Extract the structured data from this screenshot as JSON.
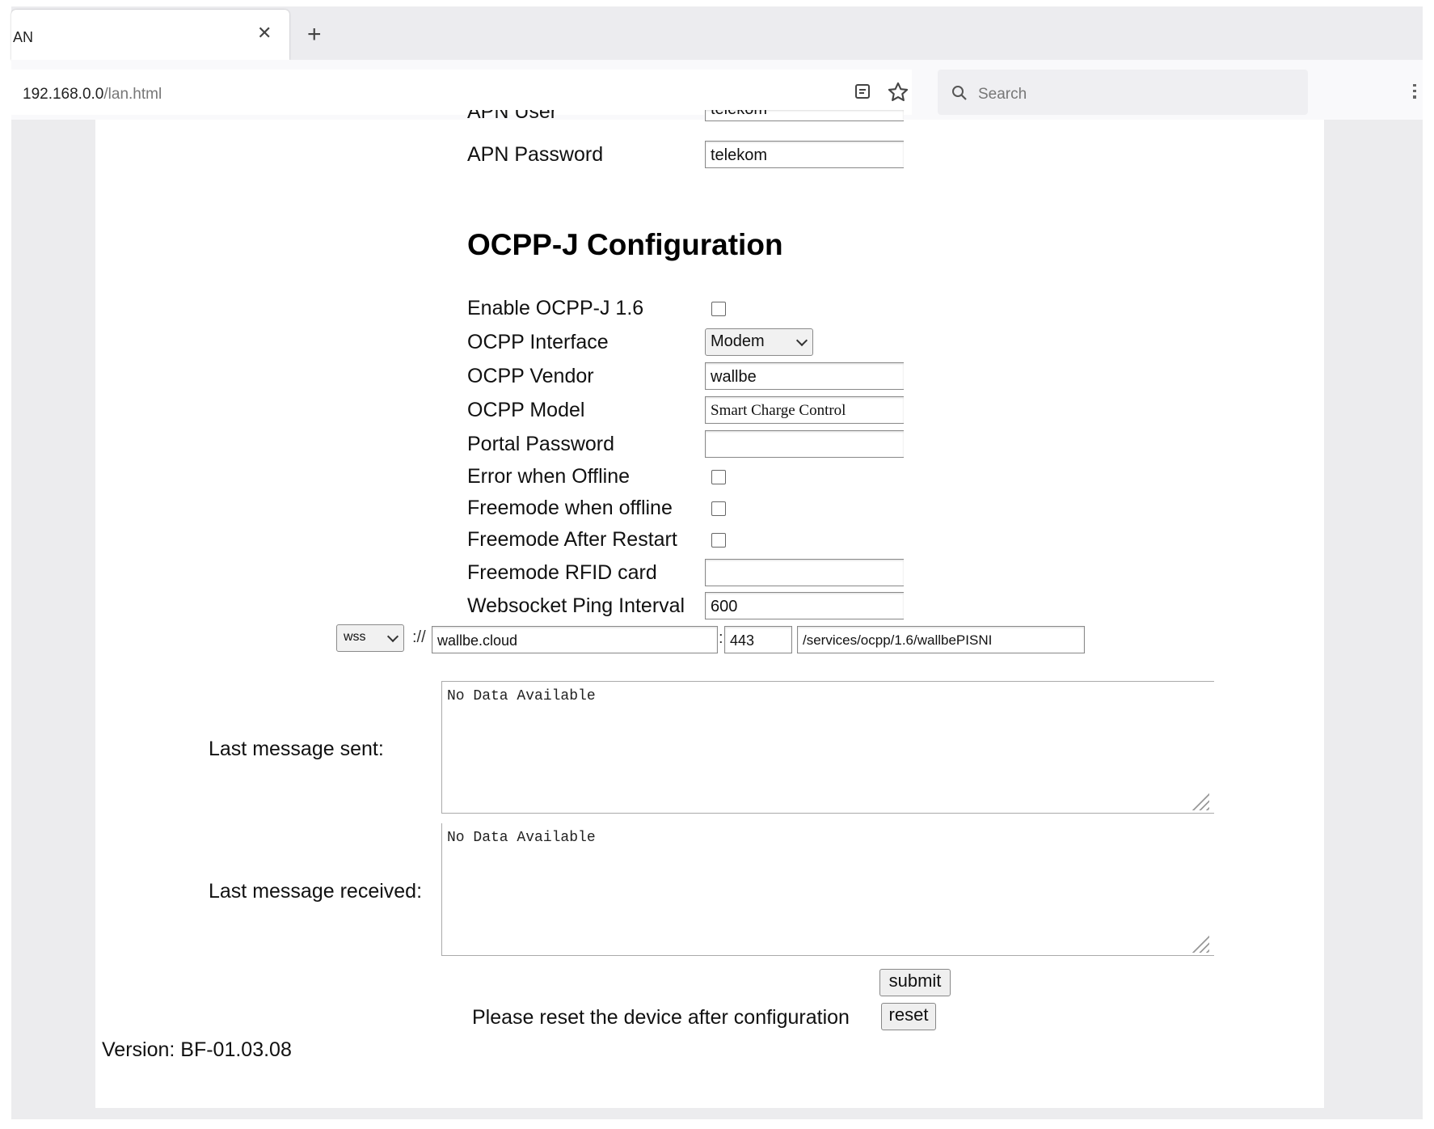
{
  "browser": {
    "tab_title": "AN",
    "url_host": "192.168.0.0",
    "url_path": "/lan.html",
    "search_placeholder": "Search"
  },
  "apn": {
    "user_label": "APN User",
    "user_value": "telekom",
    "password_label": "APN Password",
    "password_value": "telekom"
  },
  "ocpp": {
    "heading": "OCPP-J Configuration",
    "enable_label": "Enable OCPP-J 1.6",
    "enable_checked": false,
    "interface_label": "OCPP Interface",
    "interface_value": "Modem",
    "vendor_label": "OCPP Vendor",
    "vendor_value": "wallbe",
    "model_label": "OCPP Model",
    "model_value": "Smart Charge Control",
    "portal_password_label": "Portal Password",
    "portal_password_value": "",
    "error_offline_label": "Error when Offline",
    "freemode_offline_label": "Freemode when offline",
    "freemode_restart_label": "Freemode After Restart",
    "freemode_rfid_label": "Freemode RFID card",
    "freemode_rfid_value": "",
    "ping_label": "Websocket Ping Interval",
    "ping_value": "600"
  },
  "server_url": {
    "scheme": "wss",
    "separator": "://",
    "host": "wallbe.cloud",
    "colon": ":",
    "port": "443",
    "path": "/services/ocpp/1.6/wallbePISNI"
  },
  "messages": {
    "sent_label": "Last message sent:",
    "sent_value": "No Data Available",
    "received_label": "Last message received:",
    "received_value": "No Data Available"
  },
  "actions": {
    "submit_label": "submit",
    "reset_text": "Please reset the device after configuration",
    "reset_label": "reset"
  },
  "footer": {
    "version": "Version: BF-01.03.08"
  }
}
